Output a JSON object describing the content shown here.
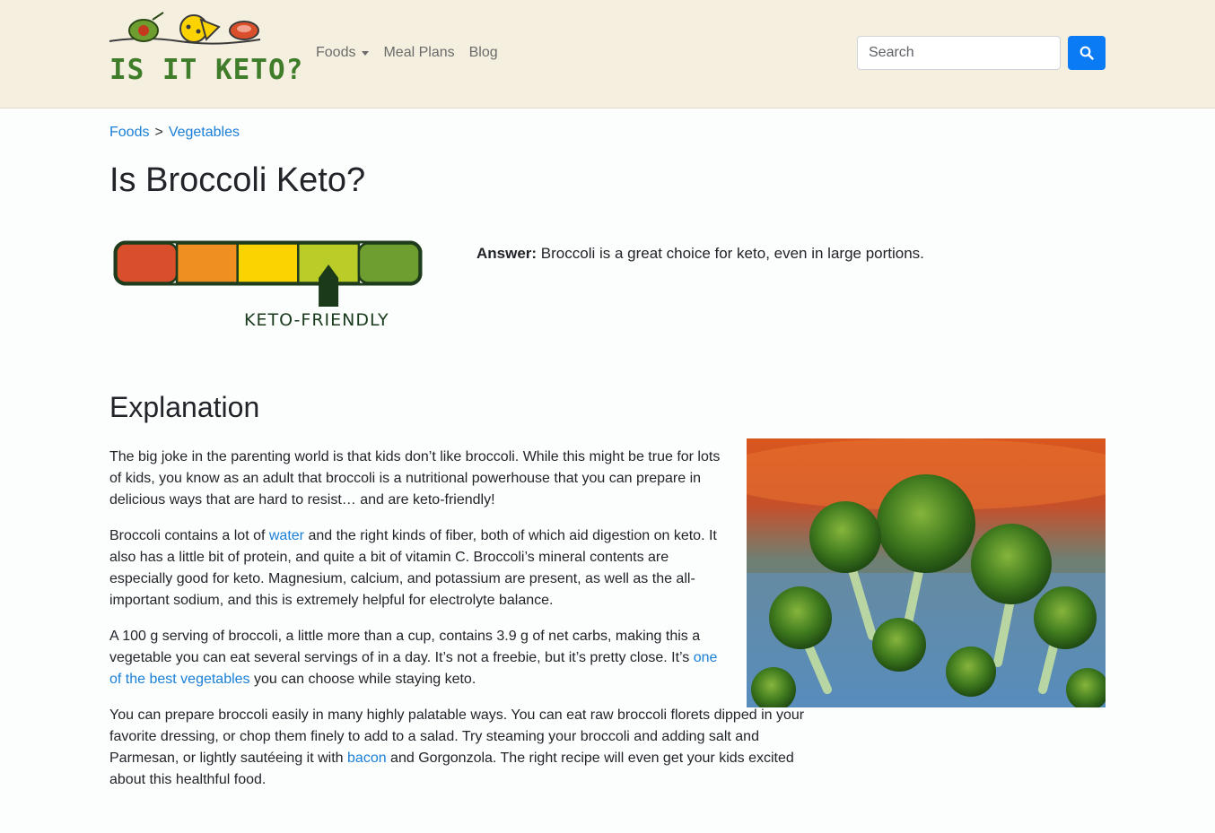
{
  "header": {
    "logo_text": "IS IT KETO?",
    "nav": [
      {
        "label": "Foods",
        "dropdown": true
      },
      {
        "label": "Meal Plans"
      },
      {
        "label": "Blog"
      }
    ],
    "search": {
      "placeholder": "Search"
    },
    "colors": {
      "background": "#f4efdf",
      "accent": "#0b7bf5"
    }
  },
  "breadcrumb": {
    "items": [
      "Foods",
      "Vegetables"
    ],
    "separator": ">"
  },
  "page_title": "Is Broccoli Keto?",
  "rating": {
    "label": "KETO-FRIENDLY",
    "level": 4,
    "max": 5,
    "segment_colors": [
      "#d94f2b",
      "#ef8f22",
      "#fbd300",
      "#bacc28",
      "#6e9e2f"
    ]
  },
  "answer": {
    "label": "Answer:",
    "text": " Broccoli is a great choice for keto, even in large portions."
  },
  "explanation": {
    "title": "Explanation",
    "p1": "The big joke in the parenting world is that kids don’t like broccoli. While this might be true for lots of kids, you know as an adult that broccoli is a nutritional powerhouse that you can prepare in delicious ways that are hard to resist… and are keto-friendly!",
    "p2_before": "Broccoli contains a lot of ",
    "p2_link": "water",
    "p2_after": " and the right kinds of fiber, both of which aid digestion on keto. It also has a little bit of protein, and quite a bit of vitamin C. Broccoli’s mineral contents are especially good for keto. Magnesium, calcium, and potassium are present, as well as the all-important sodium, and this is extremely helpful for electrolyte balance.",
    "p3_before": "A 100 g serving of broccoli, a little more than a cup, contains 3.9 g of net carbs, making this a vegetable you can eat several servings of in a day. It’s not a freebie, but it’s pretty close. It’s ",
    "p3_link": "one of the best vegetables",
    "p3_after": " you can choose while staying keto.",
    "p4_before": "You can prepare broccoli easily in many highly palatable ways. You can eat raw broccoli florets dipped in your favorite dressing, or chop them finely to add to a salad. Try steaming your broccoli and adding salt and Parmesan, or lightly sautéeing it with ",
    "p4_link": "bacon",
    "p4_after": " and Gorgonzola. The right recipe will even get your kids excited about this healthful food."
  }
}
